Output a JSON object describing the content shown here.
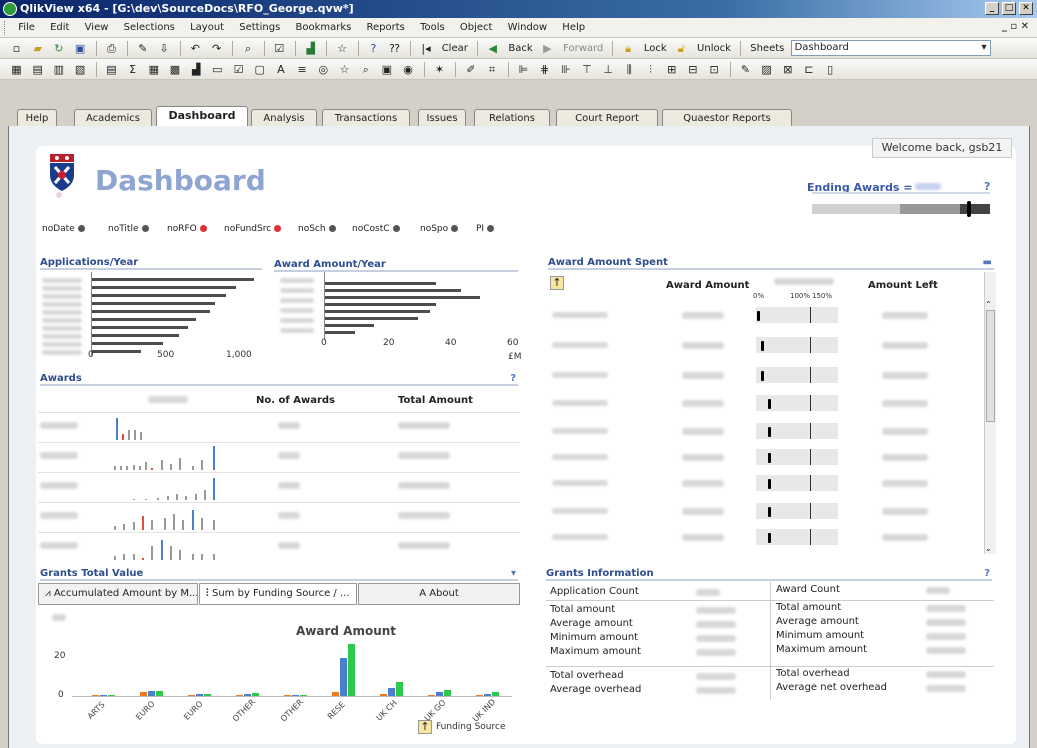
{
  "window": {
    "title": "QlikView x64 - [G:\\dev\\SourceDocs\\RFO_George.qvw*]"
  },
  "menu": [
    "File",
    "Edit",
    "View",
    "Selections",
    "Layout",
    "Settings",
    "Bookmarks",
    "Reports",
    "Tools",
    "Object",
    "Window",
    "Help"
  ],
  "toolbar": {
    "clear": "Clear",
    "back": "Back",
    "forward": "Forward",
    "lock": "Lock",
    "unlock": "Unlock",
    "sheets_label": "Sheets",
    "sheet_value": "Dashboard"
  },
  "tabs": [
    "Help",
    "Academics",
    "Dashboard",
    "Analysis",
    "Transactions",
    "Issues",
    "Relations",
    "Court Report",
    "Quaestor Reports"
  ],
  "active_tab": "Dashboard",
  "welcome": "Welcome back,  gsb21",
  "page_title": "Dashboard",
  "ending_awards": {
    "label": "Ending Awards =",
    "help": "?",
    "level": 0.88
  },
  "flags": [
    {
      "label": "noDate",
      "color": "#555555"
    },
    {
      "label": "noTitle",
      "color": "#555555"
    },
    {
      "label": "noRFO",
      "color": "#e03030"
    },
    {
      "label": "noFundSrc",
      "color": "#e03030"
    },
    {
      "label": "noSch",
      "color": "#555555"
    },
    {
      "label": "noCostC",
      "color": "#555555"
    },
    {
      "label": "noSpo",
      "color": "#555555"
    },
    {
      "label": "PI",
      "color": "#555555"
    }
  ],
  "applications_year": {
    "title": "Applications/Year",
    "ticks": [
      "0",
      "500",
      "1,000"
    ],
    "values": [
      1180,
      1050,
      980,
      900,
      860,
      760,
      700,
      640,
      520,
      360
    ]
  },
  "award_year": {
    "title": "Award Amount/Year",
    "ticks": [
      "0",
      "20",
      "40",
      "60"
    ],
    "unit": "£M",
    "values": [
      36,
      44,
      50,
      36,
      34,
      30,
      16,
      10
    ]
  },
  "awards": {
    "title": "Awards",
    "help": "?",
    "col_awards": "No. of Awards",
    "col_total": "Total Amount"
  },
  "award_spent": {
    "title": "Award Amount Spent",
    "col_amount": "Award Amount",
    "col_left": "Amount Left",
    "scale": [
      "0%",
      "100%",
      "150%"
    ],
    "gauge_values": [
      0.02,
      0.1,
      0.1,
      0.22,
      0.22,
      0.22,
      0.22,
      0.22,
      0.22,
      0.22
    ]
  },
  "grants_total": {
    "title": "Grants Total Value",
    "tabs": [
      "Accumulated Amount by M...",
      "Sum by Funding Source / ...",
      "About"
    ],
    "chart_title": "Award Amount",
    "ytick": "20",
    "ytick0": "0",
    "categories": [
      "ARTS",
      "EURO",
      "EURO",
      "OTHER",
      "OTHER",
      "RESE",
      "UK CH",
      "UK GO",
      "UK IND"
    ],
    "legend": "Funding Source"
  },
  "chart_data": {
    "type": "bar",
    "title": "Award Amount",
    "categories": [
      "ARTS",
      "EURO",
      "EURO",
      "OTHER",
      "OTHER",
      "RESE",
      "UK CH",
      "UK GO",
      "UK IND"
    ],
    "series": [
      {
        "values": [
          0,
          2,
          0.5,
          0.5,
          0.2,
          2,
          1,
          0.3,
          0.2
        ]
      },
      {
        "values": [
          0.3,
          2.5,
          0.8,
          0.8,
          0.3,
          19,
          4,
          2,
          0.8
        ]
      },
      {
        "values": [
          0,
          2.5,
          0.8,
          1.5,
          0.5,
          26,
          7,
          3,
          2
        ]
      }
    ],
    "ylim": [
      0,
      30
    ],
    "xlabel": "Funding Source"
  },
  "grants_info": {
    "title": "Grants Information",
    "help": "?",
    "left": [
      "Application Count",
      "Total amount",
      "Average amount",
      "Minimum amount",
      "Maximum amount",
      "Total overhead",
      "Average overhead"
    ],
    "right": [
      "Award Count",
      "Total amount",
      "Average amount",
      "Minimum amount",
      "Maximum amount",
      "Total overhead",
      "Average  net overhead"
    ]
  },
  "colors": {
    "accent": "#2e4d8e",
    "blue": "#4a7fd0",
    "green": "#2ec84a",
    "orange": "#f07a1a",
    "red": "#e84a3b"
  }
}
